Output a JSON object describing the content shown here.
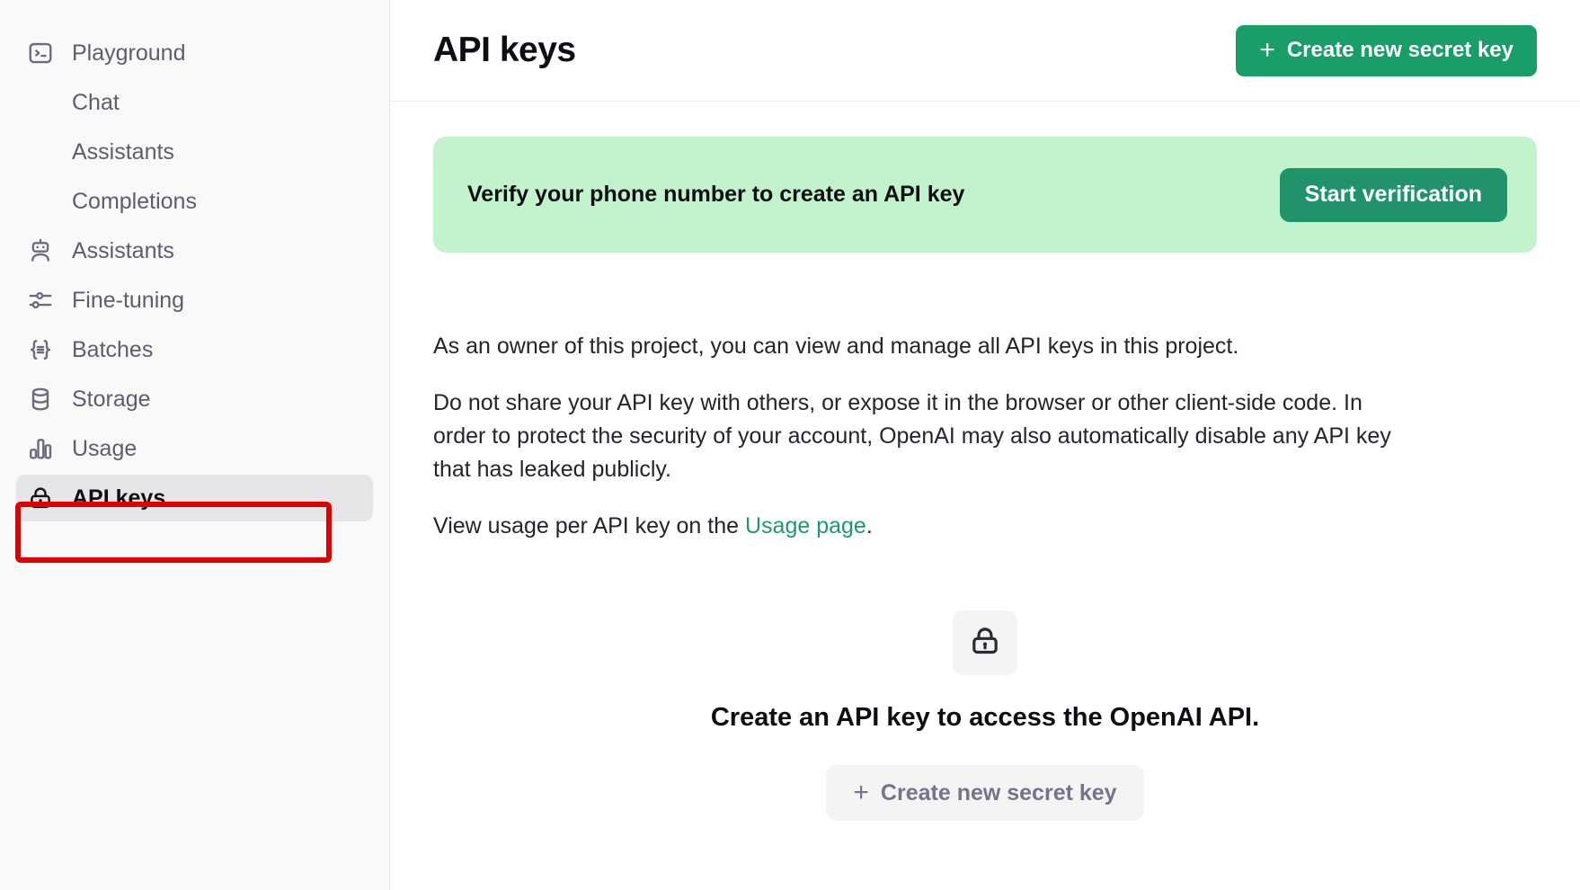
{
  "sidebar": {
    "items": [
      {
        "label": "Playground",
        "icon": "terminal-icon",
        "sub": false,
        "active": false
      },
      {
        "label": "Chat",
        "icon": "none",
        "sub": true,
        "active": false
      },
      {
        "label": "Assistants",
        "icon": "none",
        "sub": true,
        "active": false
      },
      {
        "label": "Completions",
        "icon": "none",
        "sub": true,
        "active": false
      },
      {
        "label": "Assistants",
        "icon": "robot-icon",
        "sub": false,
        "active": false
      },
      {
        "label": "Fine-tuning",
        "icon": "sliders-icon",
        "sub": false,
        "active": false
      },
      {
        "label": "Batches",
        "icon": "braces-icon",
        "sub": false,
        "active": false
      },
      {
        "label": "Storage",
        "icon": "database-icon",
        "sub": false,
        "active": false
      },
      {
        "label": "Usage",
        "icon": "barchart-icon",
        "sub": false,
        "active": false
      },
      {
        "label": "API keys",
        "icon": "lock-icon",
        "sub": false,
        "active": true
      }
    ]
  },
  "header": {
    "title": "API keys",
    "create_key_label": "Create new secret key",
    "plus_glyph": "+"
  },
  "banner": {
    "message": "Verify your phone number to create an API key",
    "action_label": "Start verification",
    "background_color": "#c3f3cc",
    "button_color": "#20936a"
  },
  "body": {
    "paragraph_1": "As an owner of this project, you can view and manage all API keys in this project.",
    "paragraph_2": "Do not share your API key with others, or expose it in the browser or other client-side code. In order to protect the security of your account, OpenAI may also automatically disable any API key that has leaked publicly.",
    "paragraph_3_prefix": "View usage per API key on the ",
    "paragraph_3_link": "Usage page",
    "paragraph_3_suffix": "."
  },
  "empty_state": {
    "icon": "lock-icon",
    "title": "Create an API key to access the OpenAI API.",
    "button_label": "Create new secret key",
    "plus_glyph": "+"
  },
  "colors": {
    "accent_green": "#199e68",
    "link_green": "#1d9a6c",
    "highlight_red": "#e00000",
    "sidebar_bg": "#f9f9f9",
    "active_item_bg": "#e6e6e9"
  }
}
